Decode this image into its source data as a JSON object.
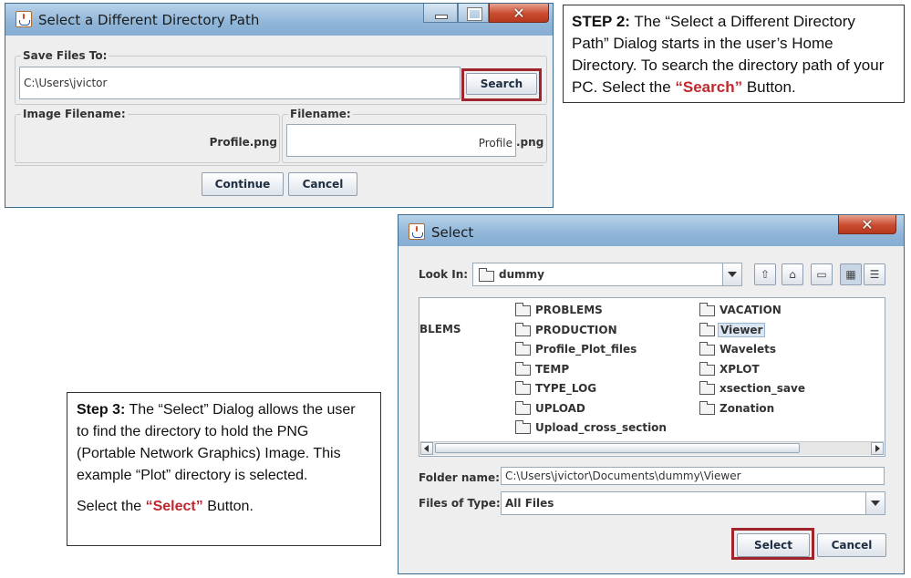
{
  "dialog1": {
    "title": "Select a Different Directory Path",
    "save_group_label": "Save Files To:",
    "path_value": "C:\\Users\\jvictor",
    "search_label": "Search",
    "image_group_label": "Image Filename:",
    "image_filename": "Profile.png",
    "filename_group_label": "Filename:",
    "filename_value": "Profile",
    "extension": ".png",
    "continue_label": "Continue",
    "cancel_label": "Cancel"
  },
  "callout_step2": {
    "lead": "STEP 2:",
    "text1": " The “Select a Different Directory Path” Dialog starts in the user’s Home Directory. To search the directory path of your PC. Select the ",
    "button_name": "“Search”",
    "text2": " Button."
  },
  "dialog2": {
    "title": "Select",
    "look_in_label": "Look In:",
    "look_in_value": "dummy",
    "partial_item": "BLEMS",
    "items_col1": [
      "PROBLEMS",
      "PRODUCTION",
      "Profile_Plot_files",
      "TEMP",
      "TYPE_LOG",
      "UPLOAD",
      "Upload_cross_section"
    ],
    "items_col2": [
      "VACATION",
      "Viewer",
      "Wavelets",
      "XPLOT",
      "xsection_save",
      "Zonation"
    ],
    "selected_item": "Viewer",
    "folder_name_label": "Folder name:",
    "folder_name_value": "C:\\Users\\jvictor\\Documents\\dummy\\Viewer",
    "files_type_label": "Files of Type:",
    "files_type_value": "All Files",
    "select_label": "Select",
    "cancel_label": "Cancel"
  },
  "callout_step3": {
    "lead": "Step 3:",
    "text1": " The “Select” Dialog allows the user to find the directory to hold the PNG (Portable Network Graphics) Image.  This example “Plot” directory is selected.",
    "text2a": "Select the ",
    "button_name": "“Select”",
    "text2b": " Button."
  },
  "colors": {
    "highlight": "#a0242b",
    "title_bar": "#8fb5d8",
    "close": "#c94b30"
  }
}
